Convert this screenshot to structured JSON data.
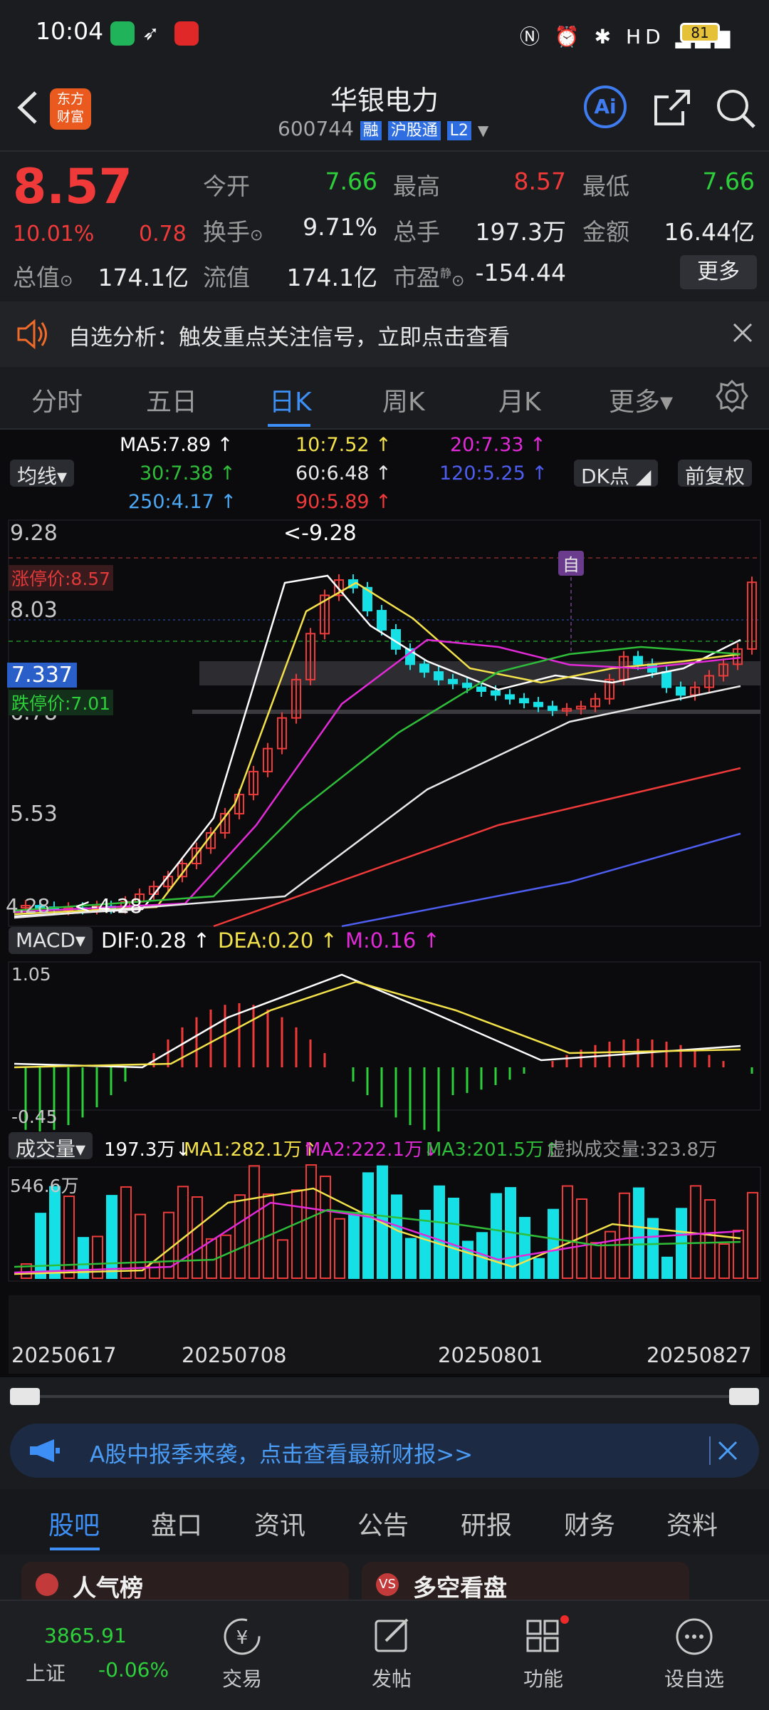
{
  "status": {
    "time": "10:04",
    "battery": "81"
  },
  "header": {
    "name": "华银电力",
    "code": "600744",
    "tags": [
      "融",
      "沪股通",
      "L2"
    ],
    "logo_line1": "东方",
    "logo_line2": "财富",
    "ai_label": "Ai"
  },
  "quote": {
    "price": "8.57",
    "pct": "10.01%",
    "chg": "0.78",
    "open_label": "今开",
    "open": "7.66",
    "high_label": "最高",
    "high": "8.57",
    "low_label": "最低",
    "low": "7.66",
    "turnover_label": "换手",
    "turnover": "9.71%",
    "vol_label": "总手",
    "vol": "197.3万",
    "amount_label": "金额",
    "amount": "16.44亿",
    "mcap_label": "总值",
    "mcap": "174.1亿",
    "float_label": "流值",
    "float": "174.1亿",
    "pe_label": "市盈",
    "pe_sup": "静",
    "pe": "-154.44",
    "more": "更多"
  },
  "notice": {
    "text": "自选分析：触发重点关注信号，立即点击查看"
  },
  "tabs": [
    "分时",
    "五日",
    "日K",
    "周K",
    "月K",
    "更多▾"
  ],
  "active_tab": 2,
  "ma_legend": {
    "ma5": "MA5:7.89 ↑",
    "ma10": "10:7.52 ↑",
    "ma20": "20:7.33 ↑",
    "ma30": "30:7.38 ↑",
    "ma60": "60:6.48 ↑",
    "ma120": "120:5.25 ↑",
    "ma250": "250:4.17 ↑",
    "ma90": "90:5.89 ↑",
    "avg_btn": "均线▾",
    "dk_btn": "DK点 ◢",
    "fq_btn": "前复权"
  },
  "kline": {
    "y_labels": [
      "9.28",
      "8.03",
      "6.78",
      "5.53",
      "4.28"
    ],
    "high_mark": "<-9.28",
    "low_mark": "<-4.28",
    "limit_up": "涨停价:8.57",
    "limit_down": "跌停价:7.01",
    "cur": "7.337",
    "zi": "自"
  },
  "macd": {
    "btn": "MACD▾",
    "dif": "DIF:0.28 ↑",
    "dea": "DEA:0.20 ↑",
    "m": "M:0.16 ↑",
    "ymax": "1.05",
    "ymin": "-0.45"
  },
  "volume": {
    "btn": "成交量▾",
    "vol": "197.3万↓",
    "ma1": "MA1:282.1万↑",
    "ma2": "MA2:222.1万↓",
    "ma3": "MA3:201.5万↑",
    "virtual": "虚拟成交量:323.8万",
    "ymax": "546.6万"
  },
  "dates": [
    "20250617",
    "20250708",
    "20250801",
    "20250827"
  ],
  "ad": {
    "text": "A股中报季来袭，点击查看最新财报>>"
  },
  "subtabs": [
    "股吧",
    "盘口",
    "资讯",
    "公告",
    "研报",
    "财务",
    "资料"
  ],
  "peek": {
    "left": "人气榜",
    "right": "多空看盘"
  },
  "nav": {
    "index_value": "3865.91",
    "index_name": "上证",
    "index_chg": "-0.06%",
    "items": [
      "交易",
      "发帖",
      "功能",
      "设自选"
    ]
  }
}
